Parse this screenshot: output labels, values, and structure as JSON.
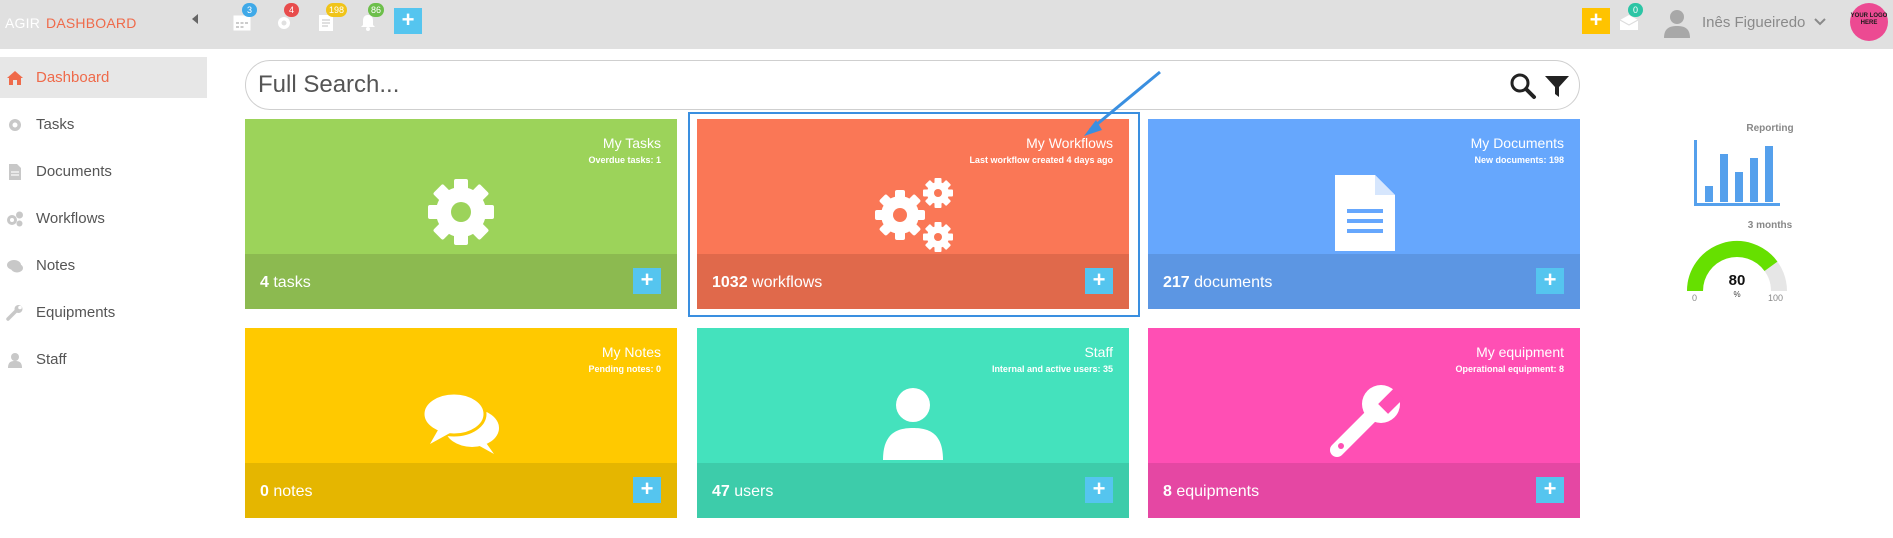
{
  "topbar": {
    "brand_app": "AGIR",
    "brand_section": "DASHBOARD",
    "badges": {
      "calendar": "3",
      "settings": "4",
      "documents": "198",
      "notifications": "86",
      "messages": "0"
    },
    "user_name": "Inês Figueiredo",
    "logo_text": "YOUR LOGO HERE"
  },
  "sidebar": {
    "items": [
      {
        "label": "Dashboard",
        "icon": "home-icon"
      },
      {
        "label": "Tasks",
        "icon": "gear-icon"
      },
      {
        "label": "Documents",
        "icon": "document-icon"
      },
      {
        "label": "Workflows",
        "icon": "gears-icon"
      },
      {
        "label": "Notes",
        "icon": "chat-icon"
      },
      {
        "label": "Equipments",
        "icon": "wrench-icon"
      },
      {
        "label": "Staff",
        "icon": "user-icon"
      }
    ]
  },
  "search": {
    "placeholder": "Full Search..."
  },
  "tiles": [
    {
      "title": "My Tasks",
      "subtitle": "Overdue tasks: 1",
      "count": "4",
      "unit": "tasks",
      "color": "#9cd35a",
      "foot_color": "#8cba50"
    },
    {
      "title": "My Workflows",
      "subtitle": "Last workflow created 4 days ago",
      "count": "1032",
      "unit": "workflows",
      "color": "#fa7756",
      "foot_color": "#e0694b"
    },
    {
      "title": "My Documents",
      "subtitle": "New documents: 198",
      "count": "217",
      "unit": "documents",
      "color": "#66a7fd",
      "foot_color": "#5c96e3"
    },
    {
      "title": "My Notes",
      "subtitle": "Pending notes: 0",
      "count": "0",
      "unit": "notes",
      "color": "#ffc900",
      "foot_color": "#e5b600"
    },
    {
      "title": "Staff",
      "subtitle": "Internal and active users: 35",
      "count": "47",
      "unit": "users",
      "color": "#44e2bd",
      "foot_color": "#3dccaa"
    },
    {
      "title": "My equipment",
      "subtitle": "Operational equipment: 8",
      "count": "8",
      "unit": "equipments",
      "color": "#ff4fb4",
      "foot_color": "#e547a3"
    }
  ],
  "reporting": {
    "label": "Reporting",
    "period": "3 months",
    "gauge": {
      "value": "80",
      "unit": "%",
      "min": "0",
      "max": "100",
      "fraction": 0.8
    }
  },
  "colors": {
    "accent": "#ef6a4a",
    "add_button": "#55c5ef",
    "highlight": "#3a8fe0"
  }
}
